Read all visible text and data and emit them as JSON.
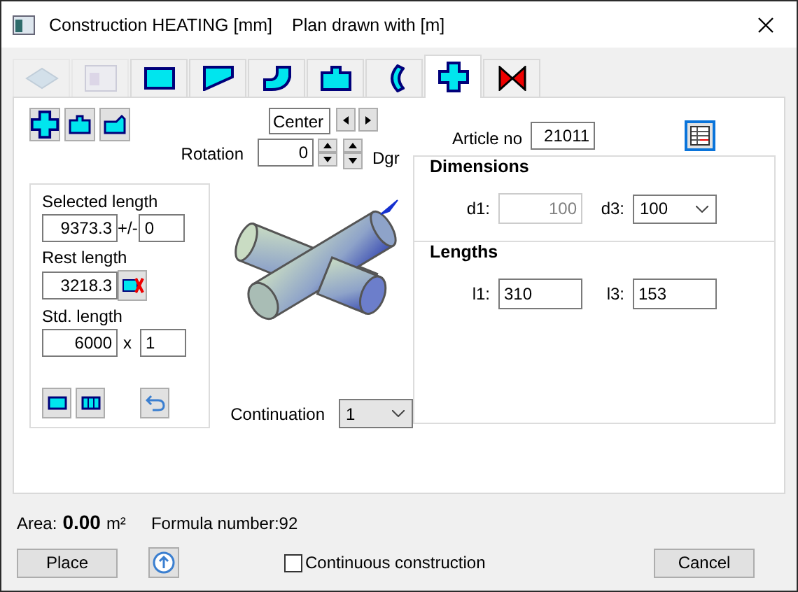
{
  "window": {
    "title": "Construction HEATING [mm]",
    "plan_unit": "Plan drawn with  [m]"
  },
  "tabs": [
    {
      "selected": false,
      "disabled": true
    },
    {
      "selected": false,
      "disabled": true
    },
    {
      "selected": false,
      "disabled": false
    },
    {
      "selected": false,
      "disabled": false
    },
    {
      "selected": false,
      "disabled": false
    },
    {
      "selected": false,
      "disabled": false
    },
    {
      "selected": false,
      "disabled": false
    },
    {
      "selected": true,
      "disabled": false
    },
    {
      "selected": false,
      "disabled": false
    }
  ],
  "position": {
    "value": "Center"
  },
  "rotation": {
    "label": "Rotation",
    "value": "0",
    "unit": "Dgr"
  },
  "article": {
    "label": "Article no",
    "value": "21011"
  },
  "length_box": {
    "selected_label": "Selected length",
    "selected_value": "9373.3",
    "tolerance_sign": "+/-",
    "tolerance": "0",
    "rest_label": "Rest length",
    "rest_value": "3218.3",
    "std_label": "Std. length",
    "std_value": "6000",
    "times": "x",
    "count": "1"
  },
  "continuation": {
    "label": "Continuation",
    "value": "1"
  },
  "dimensions": {
    "title": "Dimensions",
    "fields": [
      {
        "label": "d1:",
        "value": "100",
        "kind": "input",
        "disabled": true
      },
      {
        "label": "d3:",
        "value": "100",
        "kind": "select",
        "disabled": false
      }
    ]
  },
  "lengths": {
    "title": "Lengths",
    "fields": [
      {
        "label": "l1:",
        "value": "310",
        "kind": "input",
        "disabled": false
      },
      {
        "label": "l3:",
        "value": "153",
        "kind": "input",
        "disabled": false
      }
    ]
  },
  "status": {
    "area_label": "Area:",
    "area_value": "0.00",
    "area_unit": "m²",
    "formula": "Formula number:92"
  },
  "footer": {
    "place": "Place",
    "continuous": {
      "label": "Continuous construction",
      "checked": false
    },
    "cancel": "Cancel"
  }
}
